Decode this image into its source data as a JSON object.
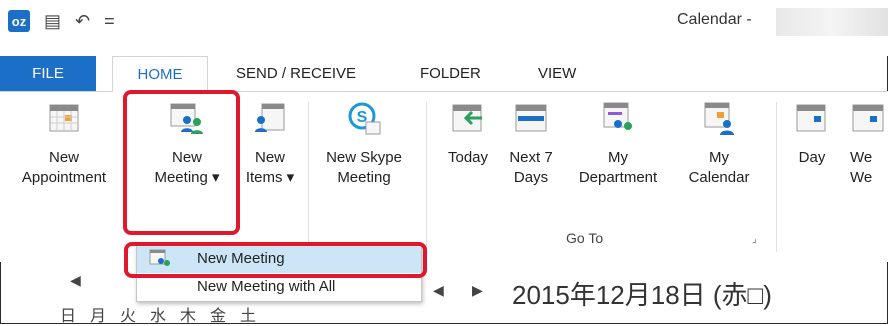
{
  "titlebar": {
    "title": "Calendar -",
    "undo_icon": "undo-icon",
    "qat_more": "="
  },
  "tabs": [
    "FILE",
    "HOME",
    "SEND / RECEIVE",
    "FOLDER",
    "VIEW"
  ],
  "ribbon": {
    "new_appointment": [
      "New",
      "Appointment"
    ],
    "new_meeting": [
      "New",
      "Meeting ▾"
    ],
    "new_items": [
      "New",
      "Items ▾"
    ],
    "new_skype": [
      "New Skype",
      "Meeting"
    ],
    "today": "Today",
    "next7": [
      "Next 7",
      "Days"
    ],
    "my_department": [
      "My",
      "Department"
    ],
    "my_calendar": [
      "My",
      "Calendar"
    ],
    "day": "Day",
    "we1": "We",
    "we2": "We",
    "go_to_label": "Go To"
  },
  "dropdown": {
    "item1": "New Meeting",
    "item2": "New Meeting with All"
  },
  "calendar": {
    "date": "2015年12月18日 (赤□)",
    "weekdays": "日月火水木金土"
  },
  "colors": {
    "accent": "#1b6fc7",
    "highlight": "#cde6f7",
    "annotation": "#e0182d"
  }
}
